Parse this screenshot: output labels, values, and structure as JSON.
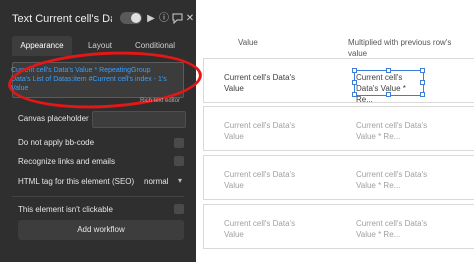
{
  "panel": {
    "title": "Text Current cell's Data's",
    "icons": [
      "toggle-switch",
      "play-icon",
      "info-icon",
      "comment-icon",
      "close-icon"
    ],
    "tabs": [
      {
        "label": "Appearance",
        "active": true
      },
      {
        "label": "Layout",
        "active": false
      },
      {
        "label": "Conditional",
        "active": false
      }
    ],
    "expression": "Current cell's Data's Value * RepeatingGroup Data's List of Datas:item #Current cell's index - 1's Value",
    "rich_text_editor": "Rich text editor",
    "canvas_placeholder_label": "Canvas placeholder",
    "no_bbcode_label": "Do not apply bb-code",
    "recognize_links_label": "Recognize links and emails",
    "html_tag_label": "HTML tag for this element (SEO)",
    "html_tag_value": "normal",
    "not_clickable_label": "This element isn't clickable",
    "add_workflow": "Add workflow",
    "colors": {
      "background": "#2f2f2f",
      "expression": "#3aa0ff",
      "annotation": "#e51616"
    }
  },
  "table": {
    "col_value": "Value",
    "col_multiplied": "Multiplied with previous row's value",
    "rows": [
      {
        "value": "Current cell's Data's Value",
        "multiplied": "Current cell's Data's Value * Re..."
      },
      {
        "value": "Current cell's Data's Value",
        "multiplied": "Current cell's Data's Value * Re..."
      },
      {
        "value": "Current cell's Data's Value",
        "multiplied": "Current cell's Data's Value * Re..."
      },
      {
        "value": "Current cell's Data's Value",
        "multiplied": "Current cell's Data's Value * Re..."
      }
    ],
    "colors": {
      "selection": "#3b7dd8",
      "border": "#d9d9d9"
    }
  }
}
